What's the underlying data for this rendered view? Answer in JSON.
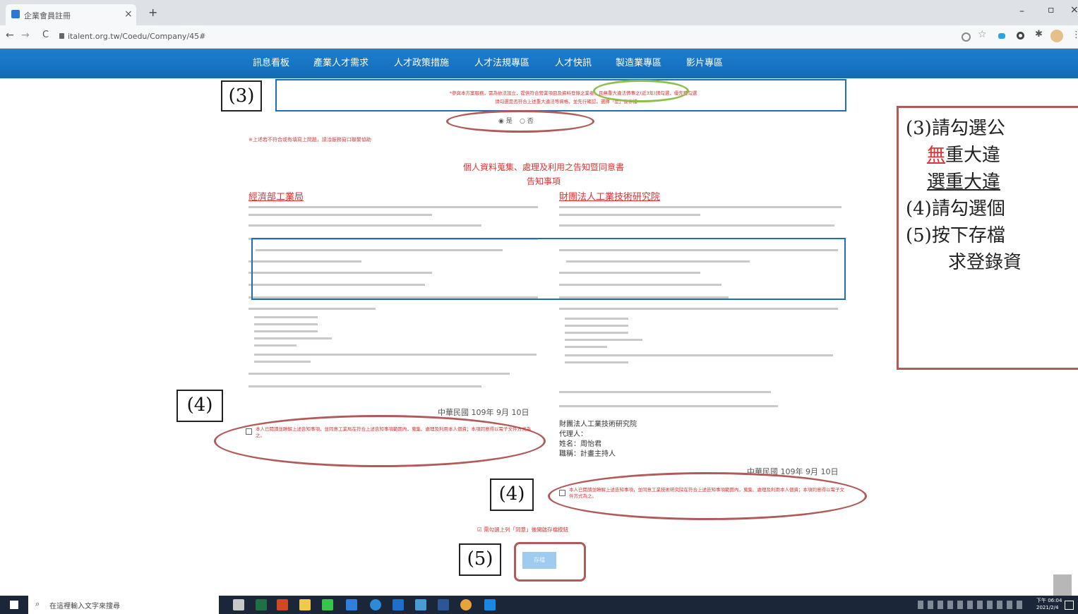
{
  "browser": {
    "tab_title": "企業會員註冊",
    "tab_close": "×",
    "new_tab": "+",
    "url": "italent.org.tw/Coedu/Company/45#",
    "nav": {
      "back": "←",
      "forward": "→",
      "reload": "C"
    },
    "window": {
      "min": "–",
      "max": "▫",
      "close": "×"
    }
  },
  "site_nav": [
    "訊息看板",
    "產業人才需求",
    "人才政策措施",
    "人才法規專區",
    "人才快訊",
    "製造業專區",
    "影片專區"
  ],
  "notice": {
    "line1": "*參與本方案服務，需為依法設立，提供符合營業項目及資料登錄之業者，且無重大違法情事之(近3年)請勾選，優先獲勾選",
    "line2": "請勾選是否符合上述重大違法等資格，並先行確認，選擇「是」後存檔"
  },
  "radio": {
    "yes": "是",
    "no": "否"
  },
  "helper_text": "※上述若不符合或有填寫上問題，請洽服務窗口聯繫協助",
  "consent": {
    "title": "個人資料蒐集、處理及利用之告知暨同意書",
    "subtitle": "告知事項",
    "left_org": "經濟部工業局",
    "right_org": "財團法人工業技術研究院",
    "left_date": "中華民國 109年 9月 10日",
    "right_date": "中華民國 109年 9月 10日",
    "left_check": "本人已閱讀並瞭解上述告知事項，並同意工業局在符合上述告知事項範圍內，蒐集、處理及利用本人個資；本項同意得以電子文件方式為之。",
    "right_check": "本人已閱讀並瞭解上述告知事項，並同意工業技術研究院在符合上述告知事項範圍內，蒐集、處理及利用本人個資；本項同意得以電子文件方式為之。",
    "agent_title": "財團法人工業技術研究院",
    "agent_label": "代理人：",
    "agent_name": "姓名：周怡君",
    "agent_role": "職稱：計畫主持人",
    "bottom_note": "☑ 需勾選上列「同意」後開啟存檔按鈕",
    "save_button": "存檔"
  },
  "annotations": {
    "label_3": "(3)",
    "label_4a": "(4)",
    "label_4b": "(4)",
    "label_5": "(5)"
  },
  "note": {
    "line1": "(3)請勾選公",
    "line2_red": "無",
    "line2_rest": "重大違",
    "line3": "選重大違",
    "line4": "(4)請勾選個",
    "line5": "(5)按下存檔",
    "line6": "求登錄資"
  },
  "taskbar": {
    "search_placeholder": "在這裡輸入文字來搜尋",
    "time": "下午 06:04",
    "date": "2021/2/4"
  },
  "colors": {
    "nav_blue": "#1b75c6",
    "annotation_red": "#b05a5a",
    "box_blue": "#1f6fb0",
    "highlight_green": "#8dbf4a"
  }
}
